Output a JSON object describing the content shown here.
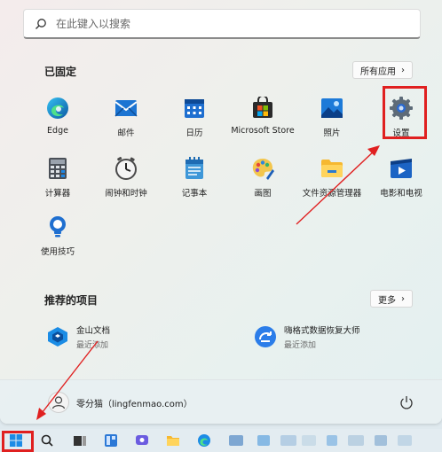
{
  "search": {
    "placeholder": "在此键入以搜索"
  },
  "pinned": {
    "title": "已固定",
    "all_apps_label": "所有应用",
    "apps": [
      {
        "label": "Edge",
        "icon": "edge-icon"
      },
      {
        "label": "邮件",
        "icon": "mail-icon"
      },
      {
        "label": "日历",
        "icon": "calendar-icon"
      },
      {
        "label": "Microsoft Store",
        "icon": "store-icon"
      },
      {
        "label": "照片",
        "icon": "photos-icon"
      },
      {
        "label": "设置",
        "icon": "gear-icon"
      },
      {
        "label": "计算器",
        "icon": "calculator-icon"
      },
      {
        "label": "闹钟和时钟",
        "icon": "clock-icon"
      },
      {
        "label": "记事本",
        "icon": "notepad-icon"
      },
      {
        "label": "画图",
        "icon": "paint-icon"
      },
      {
        "label": "文件资源管理器",
        "icon": "folder-icon"
      },
      {
        "label": "电影和电视",
        "icon": "movies-icon"
      },
      {
        "label": "使用技巧",
        "icon": "tips-icon"
      }
    ]
  },
  "recommended": {
    "title": "推荐的项目",
    "more_label": "更多",
    "items": [
      {
        "name": "金山文档",
        "sub": "最近添加",
        "icon": "kdocs-icon"
      },
      {
        "name": "嗨格式数据恢复大师",
        "sub": "最近添加",
        "icon": "recovery-icon"
      }
    ]
  },
  "user": {
    "name": "零分猫（lingfenmao.com）"
  },
  "colors": {
    "highlight": "#e02020",
    "accent": "#0067c0"
  }
}
